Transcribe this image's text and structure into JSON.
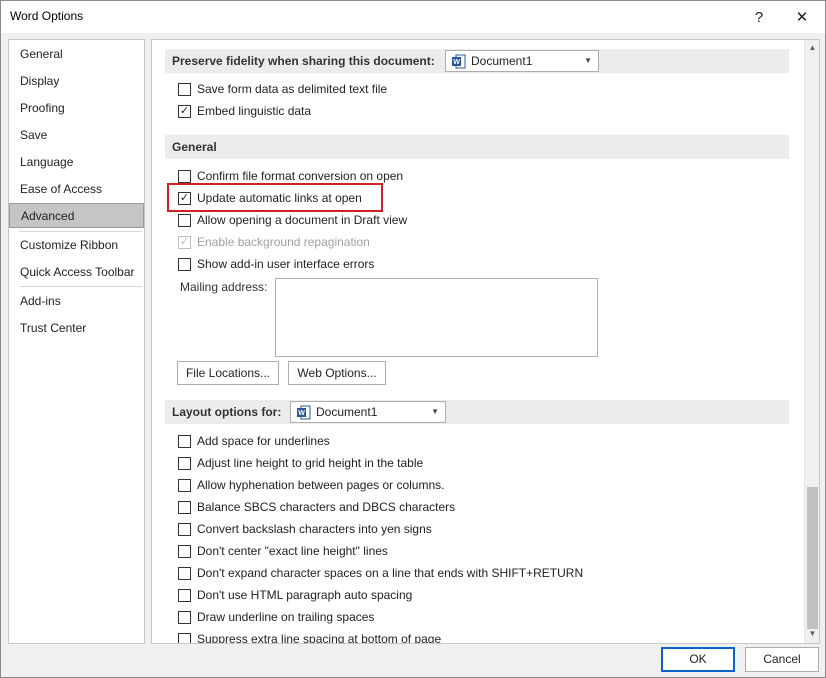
{
  "window": {
    "title": "Word Options",
    "help_glyph": "?",
    "close_glyph": "✕"
  },
  "nav": {
    "items": [
      {
        "label": "General",
        "selected": false
      },
      {
        "label": "Display",
        "selected": false
      },
      {
        "label": "Proofing",
        "selected": false
      },
      {
        "label": "Save",
        "selected": false
      },
      {
        "label": "Language",
        "selected": false
      },
      {
        "label": "Ease of Access",
        "selected": false
      },
      {
        "label": "Advanced",
        "selected": true
      },
      {
        "label": "Customize Ribbon",
        "selected": false
      },
      {
        "label": "Quick Access Toolbar",
        "selected": false
      },
      {
        "label": "Add-ins",
        "selected": false
      },
      {
        "label": "Trust Center",
        "selected": false
      }
    ]
  },
  "preserve": {
    "heading": "Preserve fidelity when sharing this document:",
    "document": "Document1",
    "options": [
      {
        "label": "Save form data as delimited text file",
        "checked": false
      },
      {
        "label": "Embed linguistic data",
        "checked": true
      }
    ]
  },
  "general": {
    "heading": "General",
    "options": [
      {
        "label": "Confirm file format conversion on open",
        "checked": false,
        "disabled": false
      },
      {
        "label": "Update automatic links at open",
        "checked": true,
        "disabled": false,
        "highlighted": true
      },
      {
        "label": "Allow opening a document in Draft view",
        "checked": false,
        "disabled": false
      },
      {
        "label": "Enable background repagination",
        "checked": true,
        "disabled": true
      },
      {
        "label": "Show add-in user interface errors",
        "checked": false,
        "disabled": false
      }
    ],
    "mailing_address_label": "Mailing address:",
    "mailing_address_value": "",
    "file_locations_button": "File Locations...",
    "web_options_button": "Web Options..."
  },
  "layout": {
    "heading": "Layout options for:",
    "document": "Document1",
    "options": [
      {
        "label": "Add space for underlines",
        "checked": false
      },
      {
        "label": "Adjust line height to grid height in the table",
        "checked": false
      },
      {
        "label": "Allow hyphenation between pages or columns.",
        "checked": false
      },
      {
        "label": "Balance SBCS characters and DBCS characters",
        "checked": false
      },
      {
        "label": "Convert backslash characters into yen signs",
        "checked": false
      },
      {
        "label": "Don't center \"exact line height\" lines",
        "checked": false
      },
      {
        "label": "Don't expand character spaces on a line that ends with SHIFT+RETURN",
        "checked": false
      },
      {
        "label": "Don't use HTML paragraph auto spacing",
        "checked": false
      },
      {
        "label": "Draw underline on trailing spaces",
        "checked": false
      },
      {
        "label": "Suppress extra line spacing at bottom of page",
        "checked": false
      }
    ]
  },
  "footer": {
    "ok_label": "OK",
    "cancel_label": "Cancel"
  },
  "icons": {
    "check": "✓",
    "dropdown": "▼",
    "scroll_up": "▲",
    "scroll_down": "▼"
  },
  "colors": {
    "highlight": "#d01f26",
    "word_icon": "#2b579a",
    "ok_border": "#0a64c8"
  }
}
